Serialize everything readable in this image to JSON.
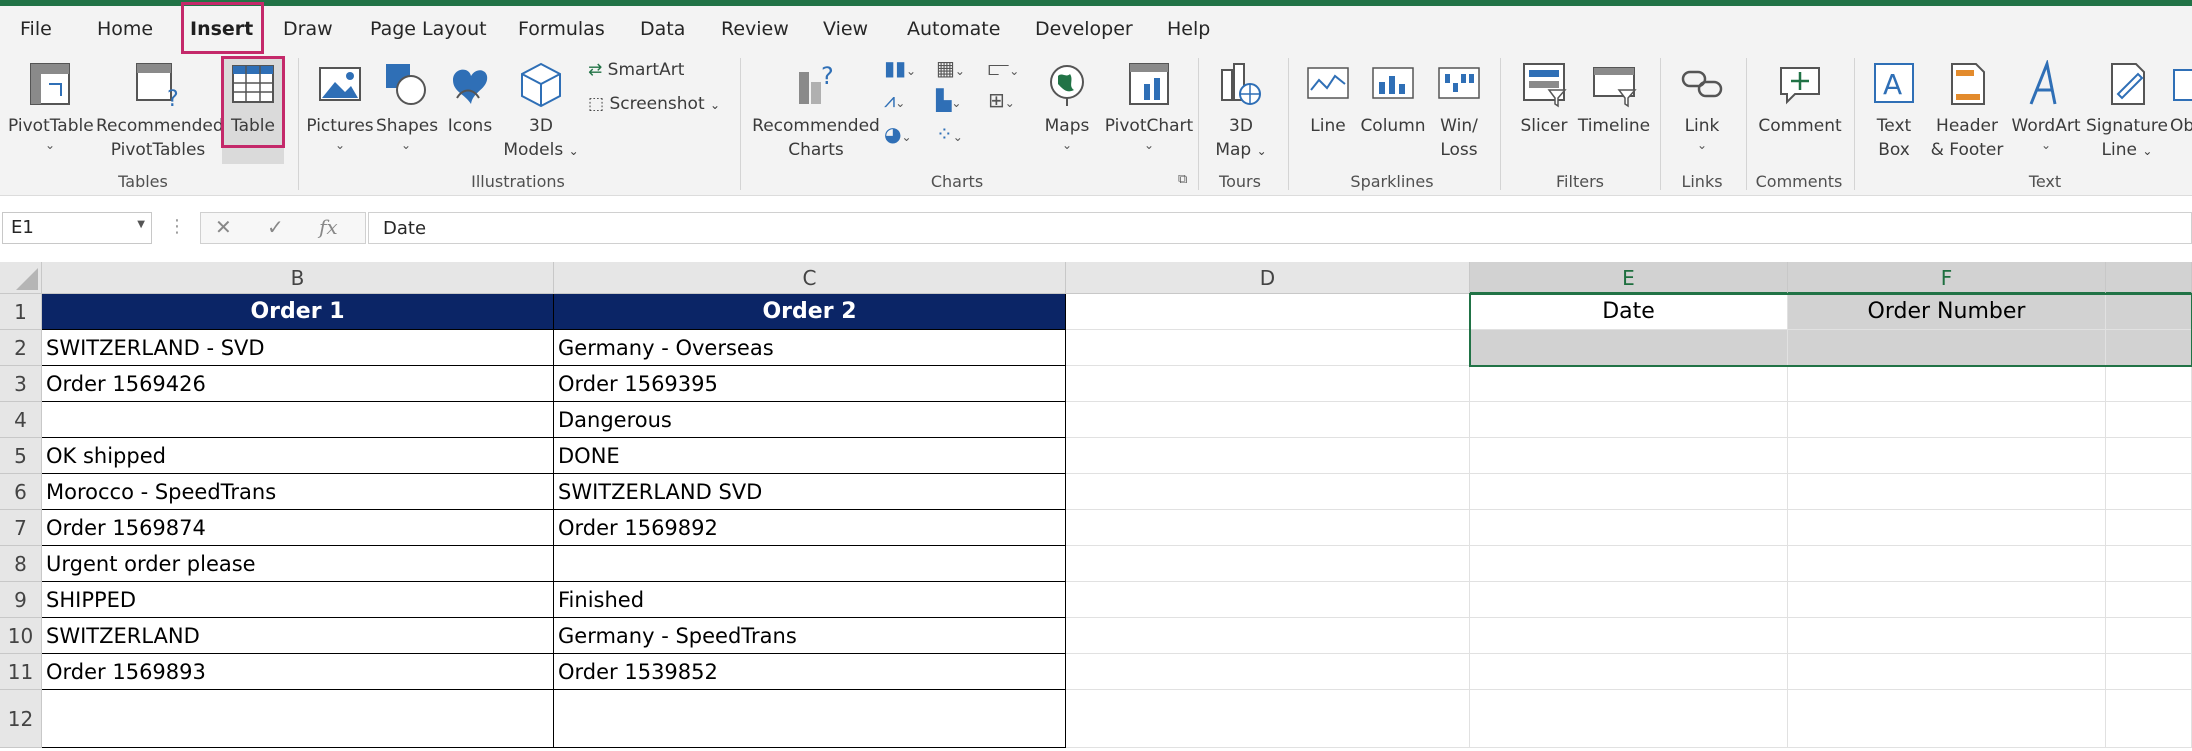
{
  "menu": {
    "file": "File",
    "home": "Home",
    "insert": "Insert",
    "draw": "Draw",
    "page_layout": "Page Layout",
    "formulas": "Formulas",
    "data": "Data",
    "review": "Review",
    "view": "View",
    "automate": "Automate",
    "developer": "Developer",
    "help": "Help"
  },
  "ribbon": {
    "tables": {
      "label": "Tables",
      "pivottable": "PivotTable",
      "recommended_l1": "Recommended",
      "recommended_l2": "PivotTables",
      "table": "Table"
    },
    "illustrations": {
      "label": "Illustrations",
      "pictures": "Pictures",
      "shapes": "Shapes",
      "icons": "Icons",
      "models_l1": "3D",
      "models_l2": "Models",
      "smartart": "SmartArt",
      "screenshot": "Screenshot"
    },
    "charts": {
      "label": "Charts",
      "recommended_l1": "Recommended",
      "recommended_l2": "Charts",
      "maps": "Maps",
      "pivotchart": "PivotChart"
    },
    "tours": {
      "label": "Tours",
      "map_l1": "3D",
      "map_l2": "Map"
    },
    "sparklines": {
      "label": "Sparklines",
      "line": "Line",
      "column": "Column",
      "winloss_l1": "Win/",
      "winloss_l2": "Loss"
    },
    "filters": {
      "label": "Filters",
      "slicer": "Slicer",
      "timeline": "Timeline"
    },
    "links": {
      "label": "Links",
      "link": "Link"
    },
    "comments": {
      "label": "Comments",
      "comment": "Comment"
    },
    "text": {
      "label": "Text",
      "textbox_l1": "Text",
      "textbox_l2": "Box",
      "header_l1": "Header",
      "header_l2": "& Footer",
      "wordart": "WordArt",
      "signature_l1": "Signature",
      "signature_l2": "Line",
      "object": "Ob"
    }
  },
  "formula_bar": {
    "name_box": "E1",
    "formula": "Date",
    "fx": "fx"
  },
  "columns": [
    "B",
    "C",
    "D",
    "E",
    "F"
  ],
  "rows": [
    "1",
    "2",
    "3",
    "4",
    "5",
    "6",
    "7",
    "8",
    "9",
    "10",
    "11",
    "12"
  ],
  "cells": {
    "B1": "Order 1",
    "C1": "Order 2",
    "B2": "SWITZERLAND - SVD",
    "C2": "Germany - Overseas",
    "B3": "Order 1569426",
    "C3": "Order 1569395",
    "B4": "",
    "C4": "Dangerous",
    "B5": "OK shipped",
    "C5": "DONE",
    "B6": "Morocco - SpeedTrans",
    "C6": "SWITZERLAND SVD",
    "B7": "Order 1569874",
    "C7": "Order 1569892",
    "B8": "Urgent order please",
    "C8": "",
    "B9": "SHIPPED",
    "C9": "Finished",
    "B10": "SWITZERLAND",
    "C10": "Germany - SpeedTrans",
    "B11": "Order 1569893",
    "C11": "Order 1539852",
    "E1": "Date",
    "F1": "Order Number"
  },
  "colors": {
    "accent": "#217346",
    "highlight": "#c4296a",
    "header_fill": "#0b2566"
  }
}
